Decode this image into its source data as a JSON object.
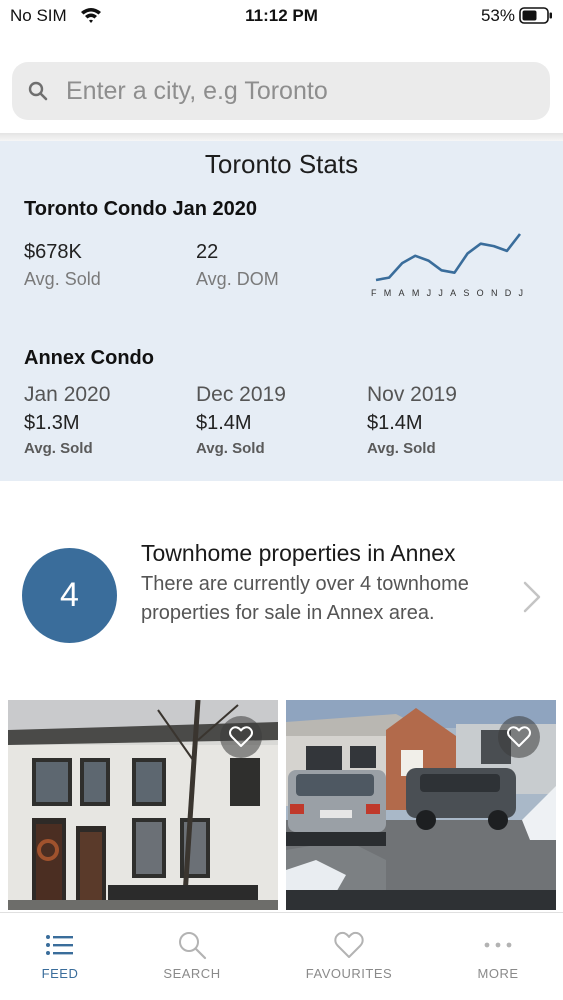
{
  "status_bar": {
    "carrier": "No SIM",
    "time": "11:12 PM",
    "battery_pct": "53%"
  },
  "search": {
    "placeholder": "Enter a city, e.g Toronto"
  },
  "stats": {
    "title": "Toronto Stats",
    "city_section": {
      "title": "Toronto Condo Jan 2020",
      "avg_sold_value": "$678K",
      "avg_sold_label": "Avg. Sold",
      "dom_value": "22",
      "dom_label": "Avg. DOM",
      "sparkline": {
        "months": [
          "F",
          "M",
          "A",
          "M",
          "J",
          "J",
          "A",
          "S",
          "O",
          "N",
          "D",
          "J"
        ],
        "values": [
          2,
          3,
          9,
          12,
          10,
          6,
          5,
          13,
          17,
          16,
          14,
          21
        ]
      }
    },
    "area_section": {
      "title": "Annex Condo",
      "periods": [
        {
          "period": "Jan 2020",
          "value": "$1.3M",
          "label": "Avg. Sold"
        },
        {
          "period": "Dec 2019",
          "value": "$1.4M",
          "label": "Avg. Sold"
        },
        {
          "period": "Nov 2019",
          "value": "$1.4M",
          "label": "Avg. Sold"
        }
      ]
    }
  },
  "promo": {
    "count": "4",
    "title": "Townhome properties in Annex",
    "description": "There are currently over 4 townhome properties for sale in Annex area."
  },
  "tabbar": {
    "items": [
      {
        "label": "FEED",
        "icon": "list-icon",
        "active": true
      },
      {
        "label": "SEARCH",
        "icon": "search-icon",
        "active": false
      },
      {
        "label": "FAVOURITES",
        "icon": "heart-icon",
        "active": false
      },
      {
        "label": "MORE",
        "icon": "more-dots-icon",
        "active": false
      }
    ]
  },
  "colors": {
    "accent": "#3a6d9b",
    "stats_bg": "#e6edf5",
    "sparkline": "#3a6d9b"
  }
}
